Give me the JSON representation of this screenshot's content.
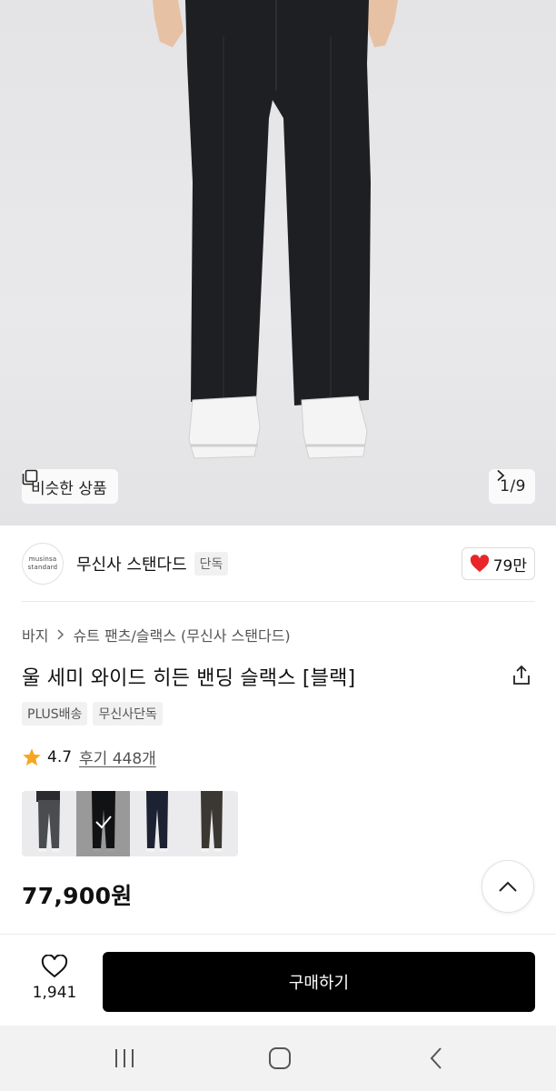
{
  "hero": {
    "similar_label": "비슷한 상품",
    "counter": "1/9"
  },
  "brand": {
    "logo_line1": "musinsa",
    "logo_line2": "standard",
    "name": "무신사 스탠다드",
    "tag": "단독",
    "likes": "79만",
    "like_color": "#e8262a"
  },
  "product": {
    "breadcrumb": [
      "바지",
      "슈트 팬츠/슬랙스 (무신사 스탠다드)"
    ],
    "title": "울 세미 와이드 히든 밴딩 슬랙스 [블랙]",
    "tags": [
      "PLUS배송",
      "무신사단독"
    ],
    "rating": "4.7",
    "reviews": "후기 448개",
    "star_color": "#f5a623",
    "swatches": [
      {
        "color": "charcoal",
        "hex": "#4a4c50",
        "selected": false
      },
      {
        "color": "black",
        "hex": "#1b1c1f",
        "selected": true
      },
      {
        "color": "navy",
        "hex": "#1d2233",
        "selected": false
      },
      {
        "color": "dark brown",
        "hex": "#3b3833",
        "selected": false
      }
    ],
    "price": "77,900원"
  },
  "bottom": {
    "wish_count": "1,941",
    "buy_label": "구매하기"
  },
  "icons": {
    "similar": "copy-icon",
    "next": "chevron-right-icon",
    "heart": "heart-icon",
    "share": "share-icon",
    "star": "star-icon",
    "check": "check-icon",
    "scroll_top": "chevron-up-icon",
    "wish": "heart-outline-icon",
    "recent_apps": "recent-apps-icon",
    "home": "home-icon",
    "back": "back-icon"
  }
}
